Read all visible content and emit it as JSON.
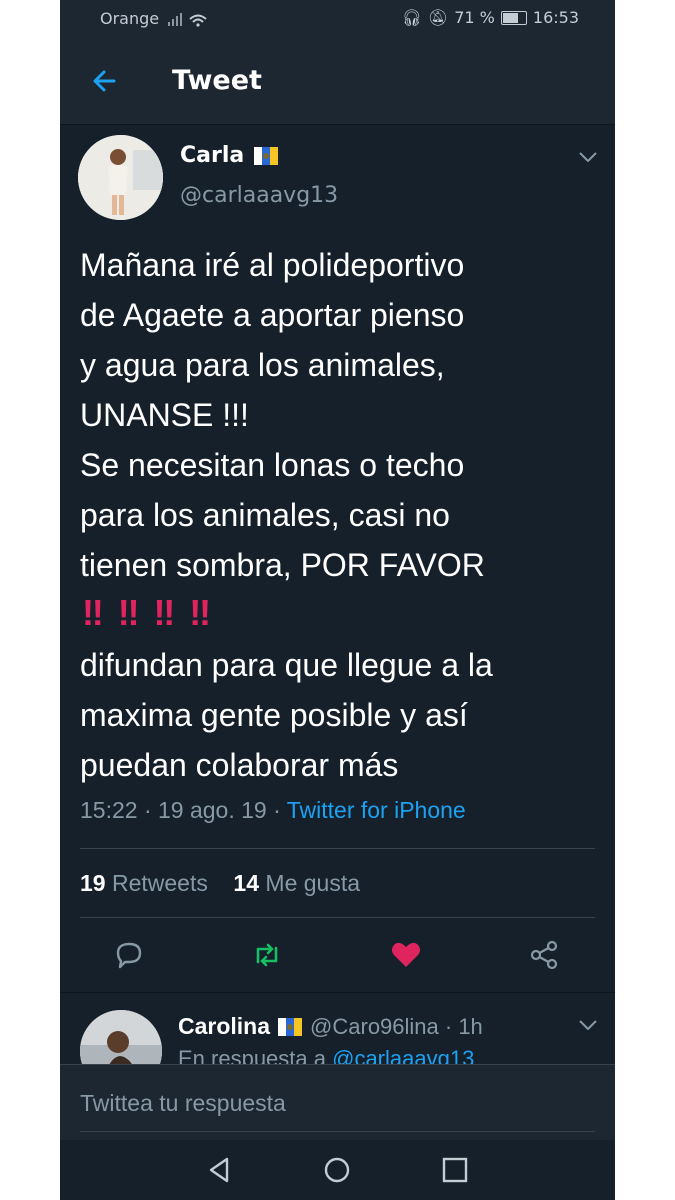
{
  "status_bar": {
    "carrier": "Orange",
    "battery": "71 %",
    "time": "16:53"
  },
  "header": {
    "title": "Tweet"
  },
  "tweet": {
    "name": "Carla",
    "handle": "@carlaaavg13",
    "text": "Mañana iré al polideportivo\nde Agaete a aportar pienso\ny agua para los animales,\nUNANSE !!!\nSe necesitan lonas o techo\npara los animales, casi no\ntienen sombra, POR FAVOR",
    "text_after": "difundan para que llegue a la\nmaxima gente posible y así\npuedan colaborar más",
    "emoji_bang": "‼",
    "time": "15:22 · 19 ago. 19 ·",
    "source": "Twitter for iPhone",
    "retweets_count": "19",
    "retweets_label": "Retweets",
    "likes_count": "14",
    "likes_label": "Me gusta"
  },
  "reply": {
    "name": "Carolina",
    "handle_time": "@Caro96lina · 1h",
    "in_reply_to": "En respuesta a",
    "in_reply_to_handle": "@carlaaavg13"
  },
  "reply_box": {
    "placeholder": "Twittea tu respuesta"
  },
  "colors": {
    "background": "#15202b",
    "accent": "#1da1f2",
    "like": "#e0245e",
    "retweet": "#17bf63",
    "muted": "#8899a6"
  }
}
